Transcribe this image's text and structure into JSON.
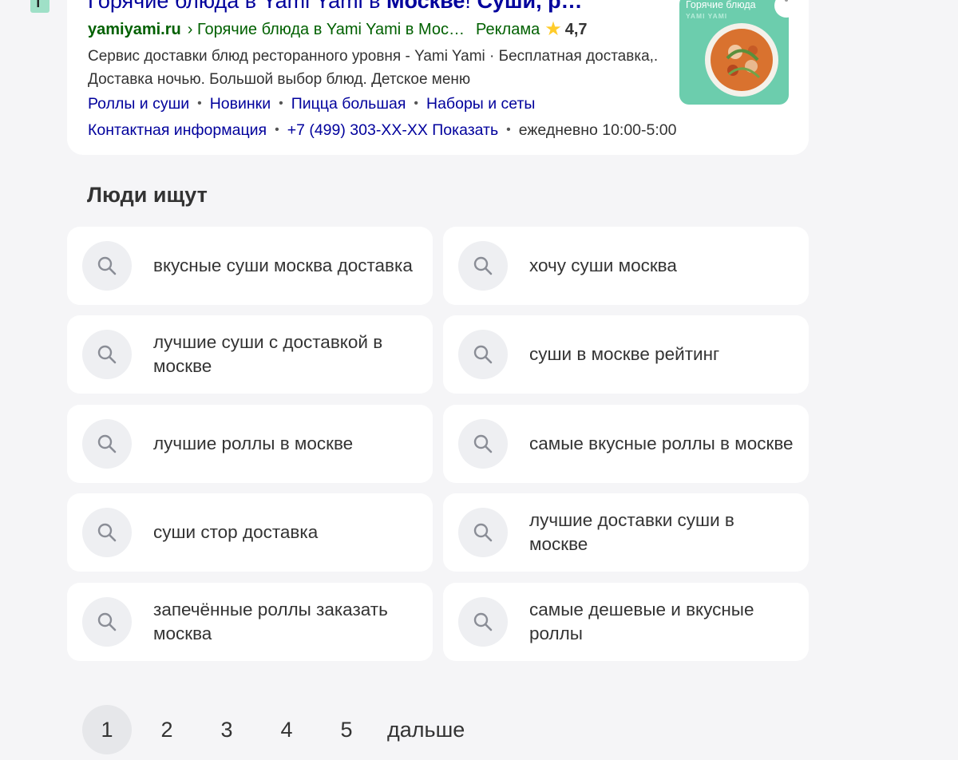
{
  "favicon": {
    "letter": "Г"
  },
  "ad": {
    "title_prefix": "Горячие блюда в Yami Yami в ",
    "title_bold1": "Москве",
    "title_mid": "! ",
    "title_bold2": "Суши",
    "title_suffix": ", р…",
    "domain": "yamiyami.ru",
    "path": "› Горячие блюда в Yami Yami в Мос…",
    "label": "Реклама",
    "rating": "4,7",
    "description": "Сервис доставки блюд ресторанного уровня - Yami Yami · Бесплатная доставка,. Доставка ночью. Большой выбор блюд. Детское меню",
    "sitelinks": [
      "Роллы и суши",
      "Новинки",
      "Пицца большая",
      "Наборы и сеты"
    ],
    "contacts": {
      "info": "Контактная информация",
      "phone": "+7 (499) 303-XX-XX Показать",
      "hours": "ежедневно 10:00-5:00"
    },
    "image": {
      "caption": "Горячие блюда",
      "brand": "YAMI YAMI"
    },
    "separator": "•"
  },
  "people_search": {
    "title": "Люди ищут",
    "items": [
      "вкусные суши москва доставка",
      "хочу суши москва",
      "лучшие суши с доставкой в москве",
      "суши в москве рейтинг",
      "лучшие роллы в москве",
      "самые вкусные роллы в москве",
      "суши стор доставка",
      "лучшие доставки суши в москве",
      "запечённые роллы заказать москва",
      "самые дешевые и вкусные роллы"
    ]
  },
  "pager": {
    "pages": [
      "1",
      "2",
      "3",
      "4",
      "5"
    ],
    "current": "1",
    "next": "дальше"
  },
  "colors": {
    "link": "#00009c",
    "green": "#006000",
    "star": "#ffcc2b",
    "background": "#f5f5f7"
  }
}
